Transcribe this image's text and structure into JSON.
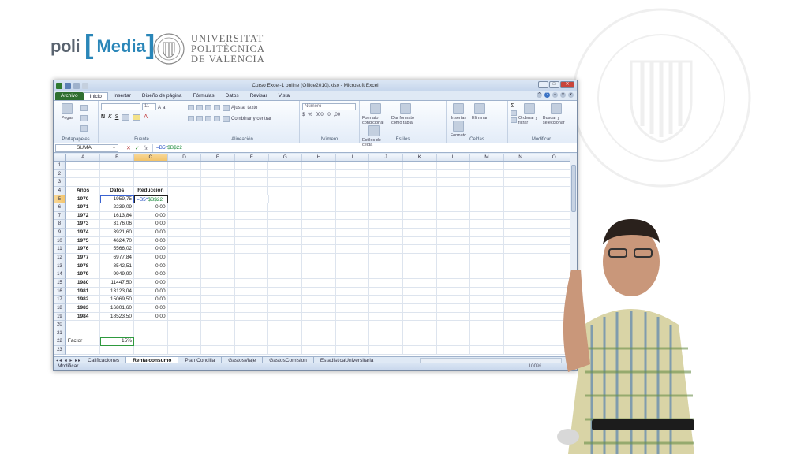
{
  "branding": {
    "poli": "poli",
    "media": "Media",
    "university": [
      "UNIVERSITAT",
      "POLITÈCNICA",
      "DE VALÈNCIA"
    ]
  },
  "window": {
    "title": "Curso Excel-1 online (Office2010).xlsx - Microsoft Excel"
  },
  "tabs": [
    "Archivo",
    "Inicio",
    "Insertar",
    "Diseño de página",
    "Fórmulas",
    "Datos",
    "Revisar",
    "Vista"
  ],
  "ribbon": {
    "groups": [
      "Portapapeles",
      "Fuente",
      "Alineación",
      "Número",
      "Estilos",
      "Celdas",
      "Modificar"
    ],
    "paste": "Pegar",
    "font_size": "11",
    "wrap_text": "Ajustar texto",
    "merge_center": "Combinar y centrar",
    "number_format": "Número",
    "cond_format": "Formato condicional",
    "table_format": "Dar formato como tabla",
    "cell_styles": "Estilos de celda",
    "insert": "Insertar",
    "delete": "Eliminar",
    "format": "Formato",
    "sort_filter": "Ordenar y filtrar",
    "find_select": "Buscar y seleccionar"
  },
  "formula_bar": {
    "name_box": "SUMA",
    "formula_a": "=B5*",
    "formula_b": "$B$22"
  },
  "columns": [
    "A",
    "B",
    "C",
    "D",
    "E",
    "F",
    "G",
    "H",
    "I",
    "J",
    "K",
    "L",
    "M",
    "N",
    "O"
  ],
  "sheet": {
    "header": {
      "a": "Años",
      "b": "Datos",
      "c": "Reducción"
    },
    "rows": [
      {
        "year": "1970",
        "datos": "1959,75"
      },
      {
        "year": "1971",
        "datos": "2239,09",
        "red": "0,00"
      },
      {
        "year": "1972",
        "datos": "1613,84",
        "red": "0,00"
      },
      {
        "year": "1973",
        "datos": "3176,06",
        "red": "0,00"
      },
      {
        "year": "1974",
        "datos": "3921,60",
        "red": "0,00"
      },
      {
        "year": "1975",
        "datos": "4624,70",
        "red": "0,00"
      },
      {
        "year": "1976",
        "datos": "5566,02",
        "red": "0,00"
      },
      {
        "year": "1977",
        "datos": "6977,84",
        "red": "0,00"
      },
      {
        "year": "1978",
        "datos": "8542,51",
        "red": "0,00"
      },
      {
        "year": "1979",
        "datos": "9949,90",
        "red": "0,00"
      },
      {
        "year": "1980",
        "datos": "11447,50",
        "red": "0,00"
      },
      {
        "year": "1981",
        "datos": "13123,04",
        "red": "0,00"
      },
      {
        "year": "1982",
        "datos": "15069,50",
        "red": "0,00"
      },
      {
        "year": "1983",
        "datos": "16801,60",
        "red": "0,00"
      },
      {
        "year": "1984",
        "datos": "18523,50",
        "red": "0,00"
      }
    ],
    "factor_label": "Factor",
    "factor_value": "15%",
    "editing_a": "=B5*",
    "editing_b": "$B$22"
  },
  "sheet_tabs": [
    "Calificaciones",
    "Renta-consumo",
    "Plan Concilia",
    "GastosViaje",
    "GastosComision",
    "EstadisticaUniversitaria"
  ],
  "status": {
    "mode": "Modificar",
    "zoom": "100%"
  }
}
